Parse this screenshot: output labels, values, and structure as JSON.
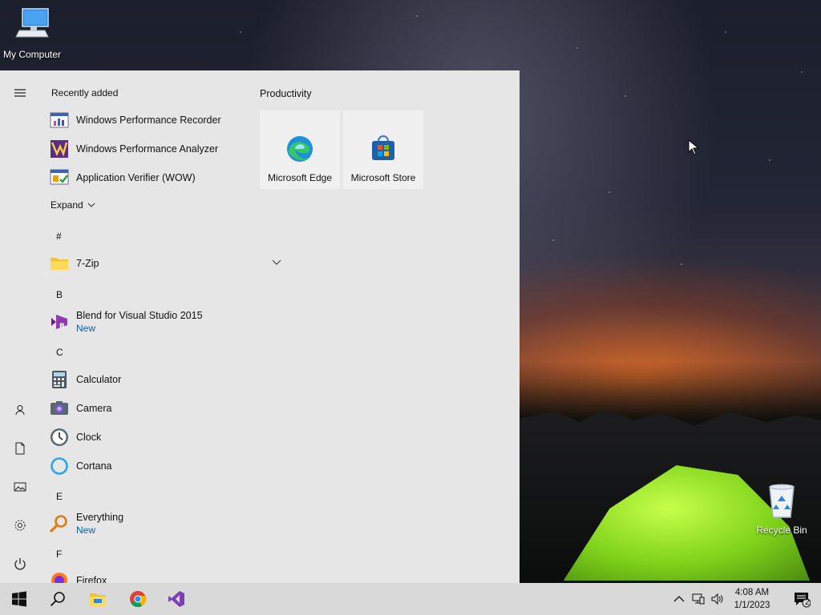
{
  "desktop": {
    "icons": [
      {
        "label": "My Computer",
        "icon": "computer-icon"
      },
      {
        "label": "Recycle Bin",
        "icon": "recycle-bin-icon"
      }
    ]
  },
  "start_menu": {
    "recently_added_title": "Recently added",
    "recent_apps": [
      {
        "name": "Windows Performance Recorder",
        "icon": "performance-recorder-icon"
      },
      {
        "name": "Windows Performance Analyzer",
        "icon": "performance-analyzer-icon"
      },
      {
        "name": "Application Verifier (WOW)",
        "icon": "app-verifier-icon"
      }
    ],
    "expand_label": "Expand",
    "letters": [
      "#",
      "B",
      "C",
      "E",
      "F"
    ],
    "apps": [
      {
        "name": "7-Zip",
        "icon": "folder-icon",
        "badge": ""
      },
      {
        "name": "Blend for Visual Studio 2015",
        "icon": "blend-icon",
        "badge": "New"
      },
      {
        "name": "Calculator",
        "icon": "calculator-icon",
        "badge": ""
      },
      {
        "name": "Camera",
        "icon": "camera-icon",
        "badge": ""
      },
      {
        "name": "Clock",
        "icon": "clock-icon",
        "badge": ""
      },
      {
        "name": "Cortana",
        "icon": "cortana-icon",
        "badge": ""
      },
      {
        "name": "Everything",
        "icon": "everything-search-icon",
        "badge": "New"
      },
      {
        "name": "Firefox",
        "icon": "firefox-icon",
        "badge": ""
      }
    ],
    "tile_group_title": "Productivity",
    "tiles": [
      {
        "label": "Microsoft Edge",
        "icon": "edge-icon"
      },
      {
        "label": "Microsoft Store",
        "icon": "store-icon"
      }
    ],
    "rail": [
      "menu-icon",
      "user-icon",
      "documents-icon",
      "pictures-icon",
      "settings-icon",
      "power-icon"
    ]
  },
  "taskbar": {
    "pinned": [
      "windows-start-icon",
      "search-icon",
      "file-explorer-icon",
      "chrome-icon",
      "visual-studio-icon"
    ],
    "tray": [
      "chevron-up-icon",
      "network-icon",
      "volume-icon"
    ],
    "time": "4:08 AM",
    "date": "1/1/2023",
    "notification_count": "2"
  },
  "colors": {
    "start_menu_bg": "#e6e6e6",
    "taskbar_bg": "#d9d9d9",
    "badge_blue": "#0f5fa8"
  }
}
